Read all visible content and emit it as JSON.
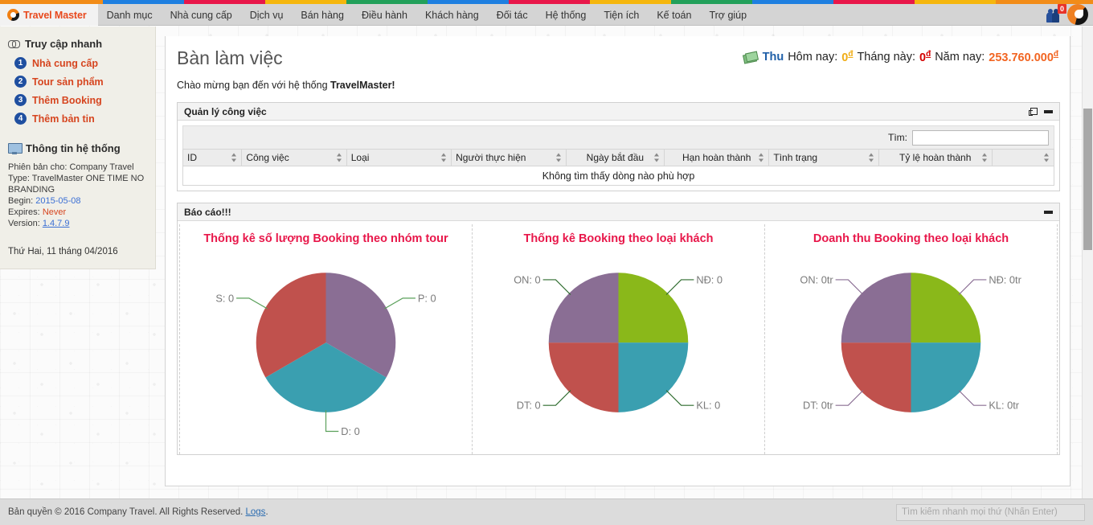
{
  "colorstrip": {
    "colors": [
      "#f28c18",
      "#1e7fe0",
      "#e8174a",
      "#f5b60d",
      "#22a05a",
      "#1e7fe0",
      "#e8174a",
      "#f5b60d",
      "#22a05a",
      "#1e7fe0",
      "#e8174a",
      "#f5b60d",
      "#f28c18"
    ]
  },
  "navbar": {
    "brand": "Travel Master",
    "brand_icon": "travel-master-logo-icon",
    "items": [
      {
        "label": "Danh mục"
      },
      {
        "label": "Nhà cung cấp"
      },
      {
        "label": "Dịch vụ"
      },
      {
        "label": "Bán hàng"
      },
      {
        "label": "Điều hành"
      },
      {
        "label": "Khách hàng"
      },
      {
        "label": "Đối tác"
      },
      {
        "label": "Hệ thống"
      },
      {
        "label": "Tiện ích"
      },
      {
        "label": "Kế toán"
      },
      {
        "label": "Trợ giúp"
      }
    ],
    "user_badge_count": "0",
    "user_icon": "users-icon",
    "avatar_icon": "avatar-icon"
  },
  "sidebar": {
    "quick_access": {
      "icon": "link-icon",
      "title": "Truy cập nhanh",
      "items": [
        {
          "num": "1",
          "label": "Nhà cung cấp"
        },
        {
          "num": "2",
          "label": "Tour sản phẩm"
        },
        {
          "num": "3",
          "label": "Thêm Booking"
        },
        {
          "num": "4",
          "label": "Thêm bản tin"
        }
      ]
    },
    "system_info": {
      "icon": "monitor-icon",
      "title": "Thông tin hệ thống",
      "edition_label": "Phiên bản cho:",
      "edition_value": "Company Travel",
      "type_label": "Type:",
      "type_value": "TravelMaster ONE TIME NO BRANDING",
      "begin_label": "Begin:",
      "begin_value": "2015-05-08",
      "expires_label": "Expires:",
      "expires_value": "Never",
      "version_label": "Version:",
      "version_value": "1.4.7.9"
    },
    "today": "Thứ Hai, 11 tháng 04/2016"
  },
  "main": {
    "page_title": "Bàn làm việc",
    "welcome_prefix": "Chào mừng bạn đến với hệ thống ",
    "welcome_brand": "TravelMaster!",
    "earnings": {
      "money_icon": "money-icon",
      "thu_label": "Thu",
      "today_label": "Hôm nay:",
      "today_value": "0",
      "month_label": "Tháng này:",
      "month_value": "0",
      "year_label": "Năm nay:",
      "year_value": "253.760.000",
      "currency": "đ"
    },
    "task_panel": {
      "title": "Quản lý công việc",
      "expand_icon": "expand-icon",
      "minimize_icon": "minimize-icon",
      "search_label": "Tìm:",
      "search_value": "",
      "search_placeholder": "",
      "columns": [
        {
          "label": "ID",
          "align": "left"
        },
        {
          "label": "Công việc",
          "align": "left"
        },
        {
          "label": "Loại",
          "align": "left"
        },
        {
          "label": "Người thực hiện",
          "align": "left"
        },
        {
          "label": "Ngày bắt đầu",
          "align": "center"
        },
        {
          "label": "Hạn hoàn thành",
          "align": "center"
        },
        {
          "label": "Tình trạng",
          "align": "left"
        },
        {
          "label": "Tỷ lệ hoàn thành",
          "align": "center"
        },
        {
          "label": "",
          "align": "left"
        }
      ],
      "empty_message": "Không tìm thấy dòng nào phù hợp"
    },
    "report_panel": {
      "title": "Báo cáo!!!",
      "minimize_icon": "minimize-icon"
    }
  },
  "chart_data": [
    {
      "type": "pie",
      "title": "Thống kê số lượng Booking theo nhóm tour",
      "labels": [
        "P",
        "D",
        "S"
      ],
      "values": [
        1,
        1,
        1
      ],
      "display_values": [
        "P: 0",
        "D: 0",
        "S: 0"
      ],
      "colors": [
        "#8a6e94",
        "#3a9fb0",
        "#c0514d"
      ],
      "start_angle": 0,
      "legend": "none",
      "connector_color": "#5aa05a"
    },
    {
      "type": "pie",
      "title": "Thống kê Booking theo loại khách",
      "labels": [
        "NĐ",
        "KL",
        "DT",
        "ON"
      ],
      "values": [
        1,
        1,
        1,
        1
      ],
      "display_values": [
        "NĐ: 0",
        "KL: 0",
        "DT: 0",
        "ON: 0"
      ],
      "colors": [
        "#8ab81a",
        "#3a9fb0",
        "#c0514d",
        "#8a6e94"
      ],
      "start_angle": 0,
      "legend": "none",
      "connector_color": "#2d6b2d"
    },
    {
      "type": "pie",
      "title": "Doanh thu Booking theo loại khách",
      "labels": [
        "NĐ",
        "KL",
        "DT",
        "ON"
      ],
      "values": [
        1,
        1,
        1,
        1
      ],
      "display_values": [
        "NĐ: 0tr",
        "KL: 0tr",
        "DT: 0tr",
        "ON: 0tr"
      ],
      "colors": [
        "#8ab81a",
        "#3a9fb0",
        "#c0514d",
        "#8a6e94"
      ],
      "start_angle": 0,
      "legend": "none",
      "connector_color": "#8a6e94"
    }
  ],
  "footer": {
    "copyright_text": "Bản quyền © 2016 Company Travel. All Rights Reserved. ",
    "logs_label": "Logs",
    "copyright_suffix": ".",
    "quick_search_placeholder": "Tìm kiếm nhanh mọi thứ (Nhấn Enter)",
    "quick_search_value": ""
  }
}
